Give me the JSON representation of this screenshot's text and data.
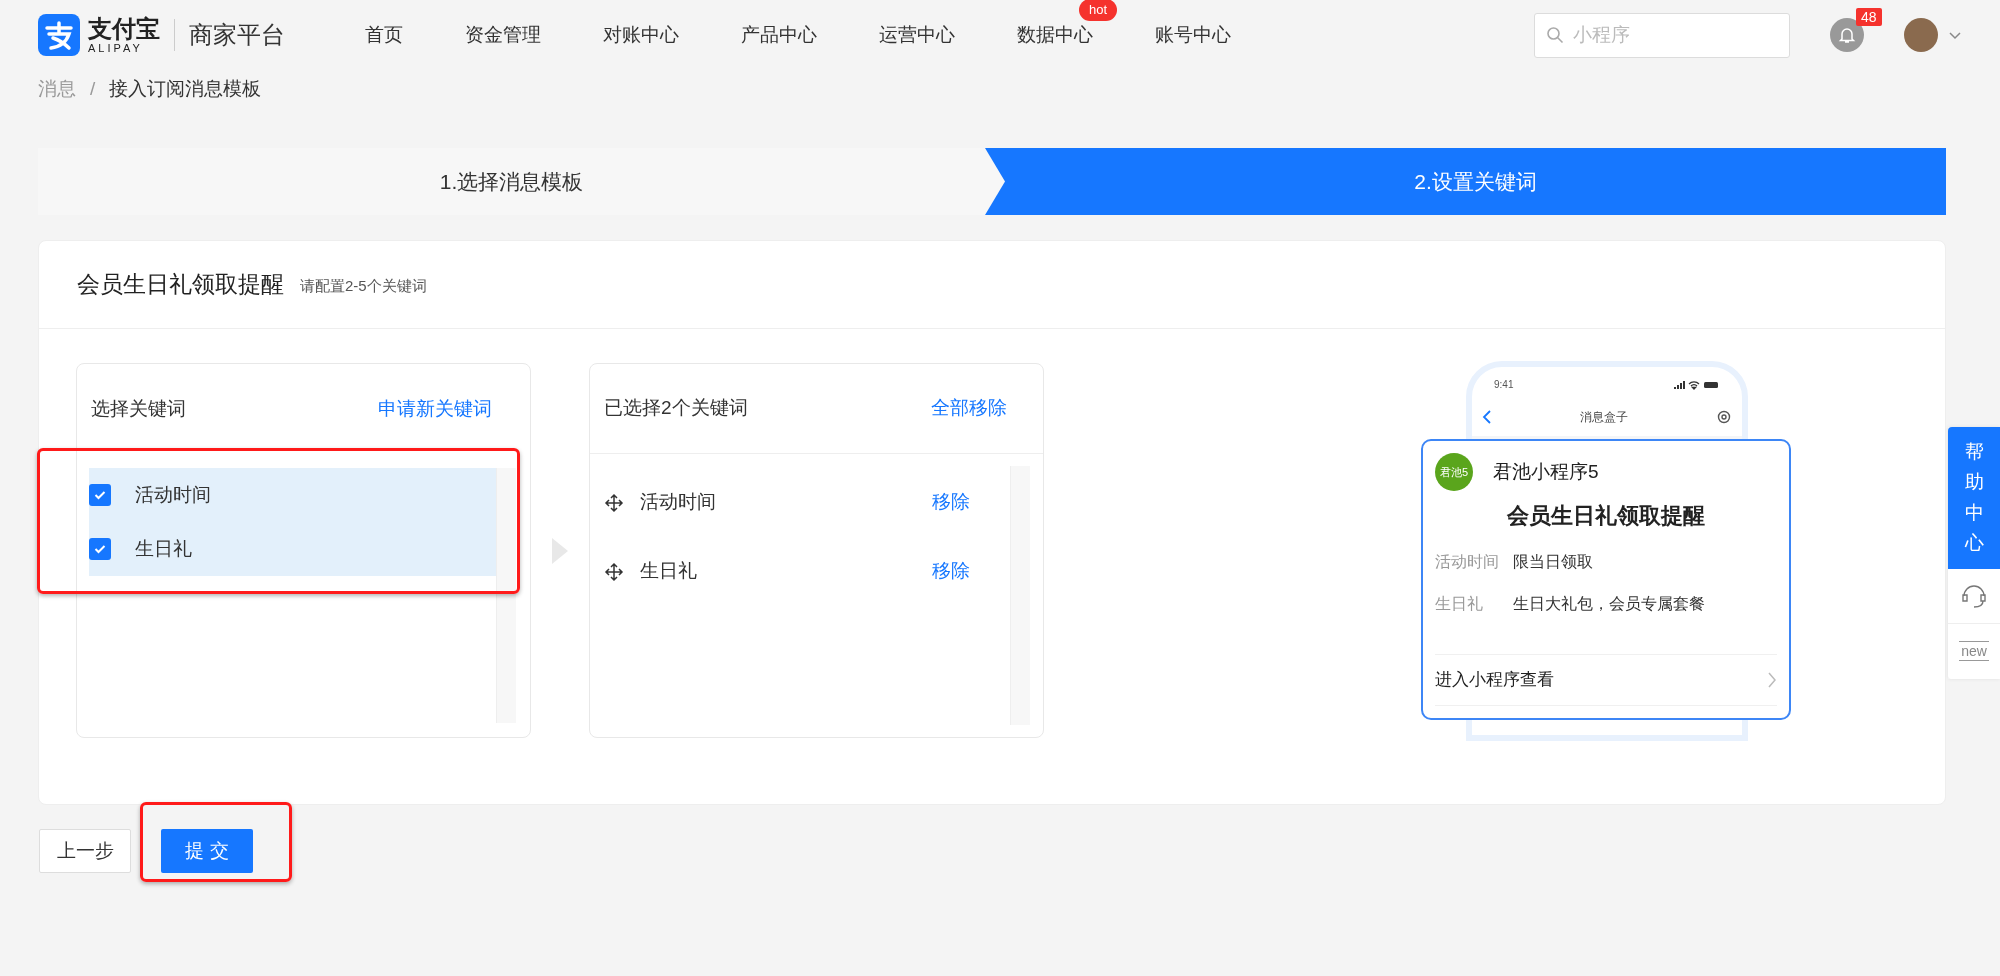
{
  "header": {
    "logo": {
      "brand": "支付宝",
      "sub": "ALIPAY"
    },
    "platform": "商家平台",
    "nav": [
      {
        "label": "首页"
      },
      {
        "label": "资金管理"
      },
      {
        "label": "对账中心"
      },
      {
        "label": "产品中心"
      },
      {
        "label": "运营中心"
      },
      {
        "label": "数据中心",
        "badge": "hot"
      },
      {
        "label": "账号中心"
      }
    ],
    "search": {
      "placeholder": "小程序"
    },
    "notifications": {
      "count": "48"
    }
  },
  "breadcrumb": {
    "separator": "/",
    "items": [
      {
        "label": "消息",
        "current": false
      },
      {
        "label": "接入订阅消息模板",
        "current": true
      }
    ]
  },
  "steps": [
    {
      "label": "1.选择消息模板",
      "active": false
    },
    {
      "label": "2.设置关键词",
      "active": true
    }
  ],
  "card": {
    "title": "会员生日礼领取提醒",
    "hint": "请配置2-5个关键词"
  },
  "available": {
    "title": "选择关键词",
    "action": "申请新关键词",
    "highlighted": true,
    "items": [
      {
        "label": "活动时间",
        "checked": true
      },
      {
        "label": "生日礼",
        "checked": true
      }
    ]
  },
  "chosen": {
    "title": "已选择2个关键词",
    "action": "全部移除",
    "items": [
      {
        "label": "活动时间",
        "remove": "移除"
      },
      {
        "label": "生日礼",
        "remove": "移除"
      }
    ]
  },
  "preview": {
    "time": "9:41",
    "screen_title": "消息盒子",
    "app_avatar": "君池5",
    "app_name": "君池小程序5",
    "title": "会员生日礼领取提醒",
    "fields": [
      {
        "label": "活动时间",
        "value": "限当日领取"
      },
      {
        "label": "生日礼",
        "value": "生日大礼包，会员专属套餐"
      }
    ],
    "link": "进入小程序查看"
  },
  "help": {
    "label": "帮助中心",
    "new": "new"
  },
  "buttons": [
    {
      "label": "上一步",
      "kind": "secondary",
      "highlighted": false
    },
    {
      "label": "提 交",
      "kind": "primary",
      "highlighted": true
    }
  ]
}
